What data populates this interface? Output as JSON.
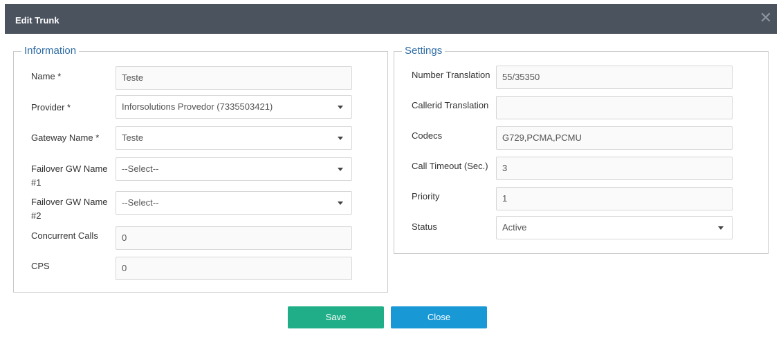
{
  "modal": {
    "title": "Edit Trunk",
    "close_glyph": "✕"
  },
  "information": {
    "legend": "Information",
    "fields": [
      {
        "label": "Name *",
        "value": "Teste",
        "type": "input"
      },
      {
        "label": "Provider *",
        "value": "Inforsolutions Provedor (7335503421)",
        "type": "select"
      },
      {
        "label": "Gateway Name *",
        "value": "Teste",
        "type": "select"
      },
      {
        "label": "Failover GW Name #1",
        "value": "--Select--",
        "type": "select"
      },
      {
        "label": "Failover GW Name #2",
        "value": "--Select--",
        "type": "select"
      },
      {
        "label": "Concurrent Calls",
        "value": "0",
        "type": "input"
      },
      {
        "label": "CPS",
        "value": "0",
        "type": "input"
      }
    ]
  },
  "settings": {
    "legend": "Settings",
    "fields": [
      {
        "label": "Number Translation",
        "value": "55/35350",
        "type": "input"
      },
      {
        "label": "Callerid Translation",
        "value": "",
        "type": "input"
      },
      {
        "label": "Codecs",
        "value": "G729,PCMA,PCMU",
        "type": "input"
      },
      {
        "label": "Call Timeout (Sec.)",
        "value": "3",
        "type": "input"
      },
      {
        "label": "Priority",
        "value": "1",
        "type": "input"
      },
      {
        "label": "Status",
        "value": "Active",
        "type": "select"
      }
    ]
  },
  "buttons": {
    "save": "Save",
    "close": "Close"
  },
  "colors": {
    "header": "#4b535f",
    "legend": "#2e6ca4",
    "save": "#20ae88",
    "close": "#1899d6"
  },
  "icons": {
    "close": "close-icon",
    "dropdown": "chevron-down-icon"
  }
}
